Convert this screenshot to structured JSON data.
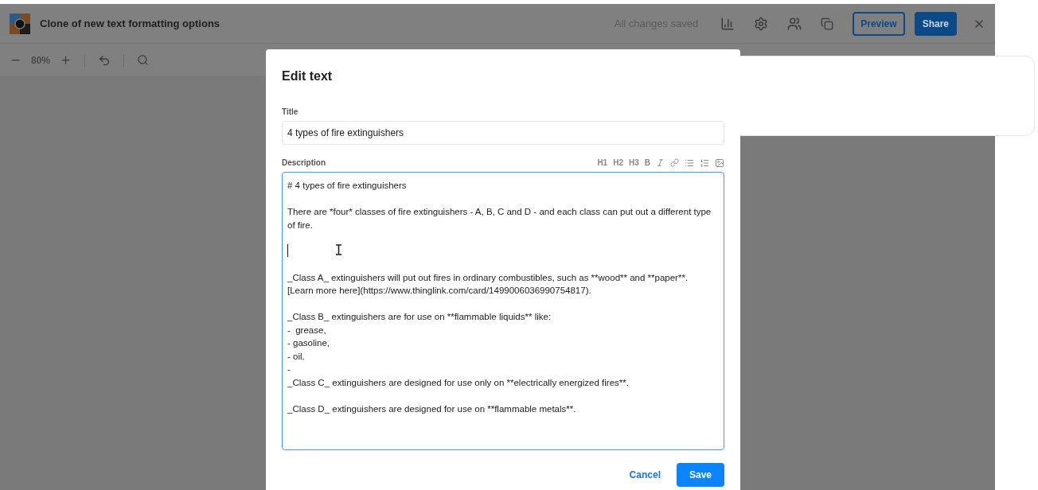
{
  "app": {
    "title": "Clone of new text formatting options",
    "status": "All changes saved",
    "buttons": [
      {
        "label": "Preview",
        "kind": "outline"
      },
      {
        "label": "Share",
        "kind": "primary"
      }
    ]
  },
  "toolbar": {
    "zoom": "80%"
  },
  "dialog": {
    "title": "Edit text",
    "fields": [
      {
        "label": "Title",
        "value": "4 types of fire extinguishers"
      },
      {
        "label": "Description",
        "value": "# 4 types of fire extinguishers\n\nThere are *four* classes of fire extinguishers - A, B, C and D - and each class can put out a different type of fire.\n\n\n\n_Class A_ extinguishers will put out fires in ordinary combustibles, such as **wood** and **paper**.  [Learn more here](https://www.thinglink.com/card/1499006036990754817).\n\n_Class B_ extinguishers are for use on **flammable liquids** like:\n-  grease,\n- gasoline,\n- oil.\n-\n_Class C_ extinguishers are designed for use only on **electrically energized fires**.\n\n_Class D_ extinguishers are designed for use on **flammable metals**."
      }
    ],
    "format_buttons": [
      "H1",
      "H2",
      "H3",
      "B"
    ],
    "buttons": [
      {
        "label": "Cancel",
        "kind": "link"
      },
      {
        "label": "Save",
        "kind": "primary"
      }
    ]
  }
}
